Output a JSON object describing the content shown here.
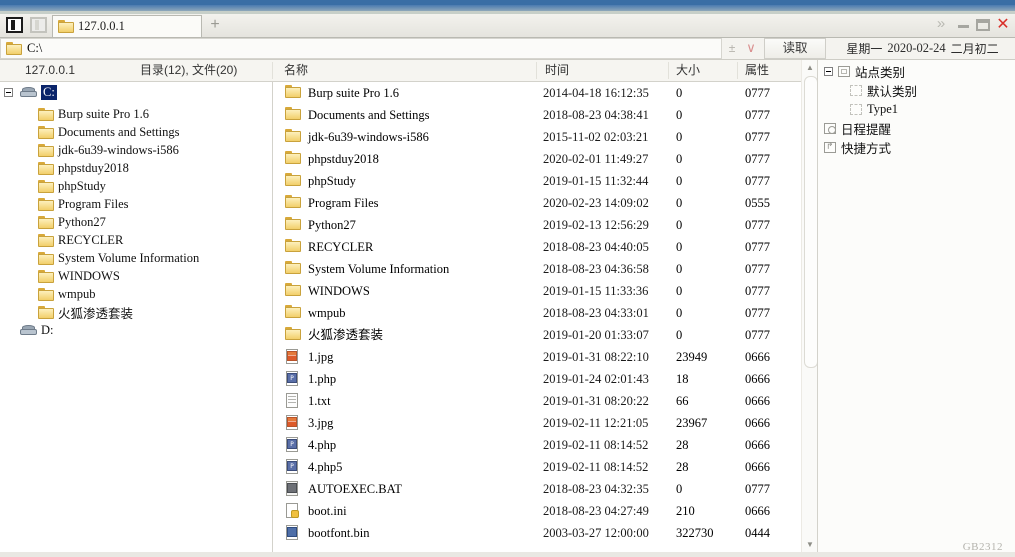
{
  "window": {
    "tab_label": "127.0.0.1",
    "tab_plus": "+",
    "new_tab_icon": "plus-icon",
    "chevron": "»",
    "close_glyph": "✕"
  },
  "address": {
    "path": "C:\\",
    "plus_minus": "±",
    "chevron": "∨",
    "read_button": "读取"
  },
  "datebar": {
    "weekday": "星期一",
    "date": "2020-02-24",
    "lunar": "二月初二"
  },
  "headers": {
    "host": "127.0.0.1",
    "counts": "目录(12), 文件(20)",
    "name": "名称",
    "time": "时间",
    "size": "大小",
    "attr": "属性"
  },
  "tree": {
    "drive_c": "C:",
    "drive_d": "D:",
    "folders": [
      "Burp suite Pro 1.6",
      "Documents and Settings",
      "jdk-6u39-windows-i586",
      "phpstduy2018",
      "phpStudy",
      "Program Files",
      "Python27",
      "RECYCLER",
      "System Volume Information",
      "WINDOWS",
      "wmpub",
      "火狐渗透套装"
    ]
  },
  "files": [
    {
      "icon": "folder",
      "name": "Burp suite Pro 1.6",
      "time": "2014-04-18 16:12:35",
      "size": "0",
      "attr": "0777"
    },
    {
      "icon": "folder",
      "name": "Documents and Settings",
      "time": "2018-08-23 04:38:41",
      "size": "0",
      "attr": "0777"
    },
    {
      "icon": "folder",
      "name": "jdk-6u39-windows-i586",
      "time": "2015-11-02 02:03:21",
      "size": "0",
      "attr": "0777"
    },
    {
      "icon": "folder",
      "name": "phpstduy2018",
      "time": "2020-02-01 11:49:27",
      "size": "0",
      "attr": "0777"
    },
    {
      "icon": "folder",
      "name": "phpStudy",
      "time": "2019-01-15 11:32:44",
      "size": "0",
      "attr": "0777"
    },
    {
      "icon": "folder",
      "name": "Program Files",
      "time": "2020-02-23 14:09:02",
      "size": "0",
      "attr": "0555"
    },
    {
      "icon": "folder",
      "name": "Python27",
      "time": "2019-02-13 12:56:29",
      "size": "0",
      "attr": "0777"
    },
    {
      "icon": "folder",
      "name": "RECYCLER",
      "time": "2018-08-23 04:40:05",
      "size": "0",
      "attr": "0777"
    },
    {
      "icon": "folder",
      "name": "System Volume Information",
      "time": "2018-08-23 04:36:58",
      "size": "0",
      "attr": "0777"
    },
    {
      "icon": "folder",
      "name": "WINDOWS",
      "time": "2019-01-15 11:33:36",
      "size": "0",
      "attr": "0777"
    },
    {
      "icon": "folder",
      "name": "wmpub",
      "time": "2018-08-23 04:33:01",
      "size": "0",
      "attr": "0777"
    },
    {
      "icon": "folder",
      "name": "火狐渗透套装",
      "time": "2019-01-20 01:33:07",
      "size": "0",
      "attr": "0777"
    },
    {
      "icon": "jpg",
      "name": "1.jpg",
      "time": "2019-01-31 08:22:10",
      "size": "23949",
      "attr": "0666"
    },
    {
      "icon": "php",
      "name": "1.php",
      "time": "2019-01-24 02:01:43",
      "size": "18",
      "attr": "0666"
    },
    {
      "icon": "txt",
      "name": "1.txt",
      "time": "2019-01-31 08:20:22",
      "size": "66",
      "attr": "0666"
    },
    {
      "icon": "jpg",
      "name": "3.jpg",
      "time": "2019-02-11 12:21:05",
      "size": "23967",
      "attr": "0666"
    },
    {
      "icon": "php",
      "name": "4.php",
      "time": "2019-02-11 08:14:52",
      "size": "28",
      "attr": "0666"
    },
    {
      "icon": "php",
      "name": "4.php5",
      "time": "2019-02-11 08:14:52",
      "size": "28",
      "attr": "0666"
    },
    {
      "icon": "bat",
      "name": "AUTOEXEC.BAT",
      "time": "2018-08-23 04:32:35",
      "size": "0",
      "attr": "0777"
    },
    {
      "icon": "ini",
      "name": "boot.ini",
      "time": "2018-08-23 04:27:49",
      "size": "210",
      "attr": "0666"
    },
    {
      "icon": "bin",
      "name": "bootfont.bin",
      "time": "2003-03-27 12:00:00",
      "size": "322730",
      "attr": "0444"
    }
  ],
  "right_panel": {
    "items": [
      {
        "label": "站点类别",
        "icon": "box-icon",
        "indent": 0,
        "expander": true,
        "en": false
      },
      {
        "label": "默认类别",
        "icon": "dashed-box-icon",
        "indent": 1,
        "expander": false,
        "en": false
      },
      {
        "label": "Type1",
        "icon": "dashed-box-icon",
        "indent": 1,
        "expander": false,
        "en": true
      },
      {
        "label": "日程提醒",
        "icon": "clock-icon",
        "indent": 0,
        "expander": false,
        "en": false
      },
      {
        "label": "快捷方式",
        "icon": "shortcut-icon",
        "indent": 0,
        "expander": false,
        "en": false
      }
    ]
  },
  "watermark": "GB2312"
}
